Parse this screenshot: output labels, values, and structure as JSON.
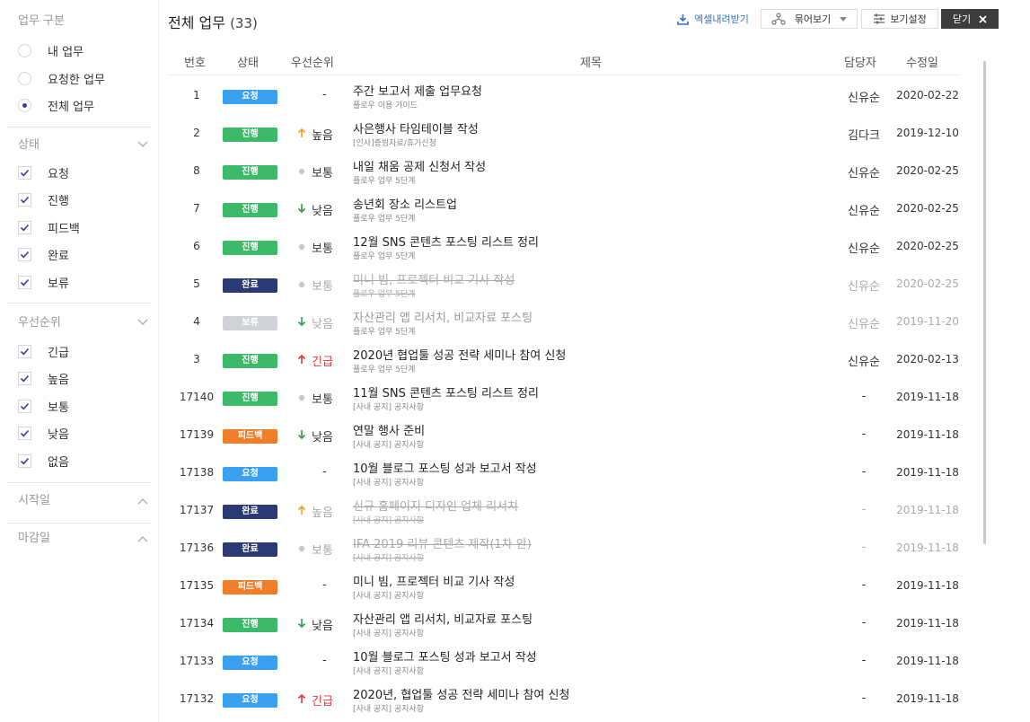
{
  "sidebar": {
    "work_type": {
      "title": "업무 구분",
      "options": [
        {
          "label": "내 업무",
          "selected": false
        },
        {
          "label": "요청한 업무",
          "selected": false
        },
        {
          "label": "전체 업무",
          "selected": true
        }
      ]
    },
    "status": {
      "title": "상태",
      "options": [
        {
          "label": "요청",
          "checked": true
        },
        {
          "label": "진행",
          "checked": true
        },
        {
          "label": "피드백",
          "checked": true
        },
        {
          "label": "완료",
          "checked": true
        },
        {
          "label": "보류",
          "checked": true
        }
      ]
    },
    "priority": {
      "title": "우선순위",
      "options": [
        {
          "label": "긴급",
          "checked": true
        },
        {
          "label": "높음",
          "checked": true
        },
        {
          "label": "보통",
          "checked": true
        },
        {
          "label": "낮음",
          "checked": true
        },
        {
          "label": "없음",
          "checked": true
        }
      ]
    },
    "start_date": {
      "title": "시작일"
    },
    "due_date": {
      "title": "마감일"
    }
  },
  "header": {
    "title": "전체 업무",
    "count": "(33)",
    "excel_label": "엑셀내려받기",
    "group_label": "묶어보기",
    "view_settings_label": "보기설정",
    "close_label": "닫기"
  },
  "columns": {
    "no": "번호",
    "status": "상태",
    "priority": "우선순위",
    "title": "제목",
    "assignee": "담당자",
    "modified": "수정일"
  },
  "colors": {
    "요청": "#3aa0f0",
    "진행": "#3cba6a",
    "완료": "#2c3a74",
    "보류": "#cfd2d6",
    "피드백": "#f07d28",
    "urgent": "#e03a3a",
    "high": "#f0a020",
    "low": "#2e9c4a",
    "normal": "#c6c6c6"
  },
  "rows": [
    {
      "no": "1",
      "status": "요청",
      "priority": "-",
      "title": "주간 보고서 제출 업무요청",
      "sub": "플로우 이용 가이드",
      "assignee": "신유순",
      "date": "2020-02-22"
    },
    {
      "no": "2",
      "status": "진행",
      "priority": "높음",
      "title": "사은행사 타임테이블 작성",
      "sub": "[인사]증빙자료/휴가신청",
      "assignee": "김다크",
      "date": "2019-12-10"
    },
    {
      "no": "8",
      "status": "진행",
      "priority": "보통",
      "title": "내일 채움 공제 신청서 작성",
      "sub": "플로우 업무 5단계",
      "assignee": "신유순",
      "date": "2020-02-25"
    },
    {
      "no": "7",
      "status": "진행",
      "priority": "낮음",
      "title": "송년회 장소 리스트업",
      "sub": "플로우 업무 5단계",
      "assignee": "신유순",
      "date": "2020-02-25"
    },
    {
      "no": "6",
      "status": "진행",
      "priority": "보통",
      "title": "12월 SNS 콘텐츠 포스팅 리스트 정리",
      "sub": "플로우 업무 5단계",
      "assignee": "신유순",
      "date": "2020-02-25"
    },
    {
      "no": "5",
      "status": "완료",
      "priority": "보통",
      "title": "미니 빔, 프로젝터 비교 기사 작성",
      "sub": "플로우 업무 5단계",
      "assignee": "신유순",
      "date": "2020-02-25"
    },
    {
      "no": "4",
      "status": "보류",
      "priority": "낮음",
      "title": "자산관리 앱 리서치, 비교자료 포스팅",
      "sub": "플로우 업무 5단계",
      "assignee": "신유순",
      "date": "2019-11-20"
    },
    {
      "no": "3",
      "status": "진행",
      "priority": "긴급",
      "title": "2020년 협업툴 성공 전략 세미나 참여 신청",
      "sub": "플로우 업무 5단계",
      "assignee": "신유순",
      "date": "2020-02-13"
    },
    {
      "no": "17140",
      "status": "진행",
      "priority": "보통",
      "title": "11월 SNS 콘텐츠 포스팅 리스트 정리",
      "sub": "[사내 공지] 공지사항",
      "assignee": "-",
      "date": "2019-11-18"
    },
    {
      "no": "17139",
      "status": "피드백",
      "priority": "낮음",
      "title": "연말 행사 준비",
      "sub": "[사내 공지] 공지사항",
      "assignee": "-",
      "date": "2019-11-18"
    },
    {
      "no": "17138",
      "status": "요청",
      "priority": "-",
      "title": "10월 블로그 포스팅 성과 보고서 작성",
      "sub": "[사내 공지] 공지사항",
      "assignee": "-",
      "date": "2019-11-18"
    },
    {
      "no": "17137",
      "status": "완료",
      "priority": "높음",
      "title": "신규 홈페이지 디자인 업체 리서치",
      "sub": "[사내 공지] 공지사항",
      "assignee": "-",
      "date": "2019-11-18"
    },
    {
      "no": "17136",
      "status": "완료",
      "priority": "보통",
      "title": "IFA 2019 리뷰 콘텐츠 제작(1차 안)",
      "sub": "[사내 공지] 공지사항",
      "assignee": "-",
      "date": "2019-11-18"
    },
    {
      "no": "17135",
      "status": "피드백",
      "priority": "-",
      "title": "미니 빔, 프로젝터 비교 기사 작성",
      "sub": "[사내 공지] 공지사항",
      "assignee": "-",
      "date": "2019-11-18"
    },
    {
      "no": "17134",
      "status": "진행",
      "priority": "낮음",
      "title": "자산관리 앱 리서치, 비교자료 포스팅",
      "sub": "[사내 공지] 공지사항",
      "assignee": "-",
      "date": "2019-11-18"
    },
    {
      "no": "17133",
      "status": "요청",
      "priority": "-",
      "title": "10월 블로그 포스팅 성과 보고서 작성",
      "sub": "[사내 공지] 공지사항",
      "assignee": "-",
      "date": "2019-11-18"
    },
    {
      "no": "17132",
      "status": "요청",
      "priority": "긴급",
      "title": "2020년, 협업툴 성공 전략 세미나 참여 신청",
      "sub": "[사내 공지] 공지사항",
      "assignee": "-",
      "date": "2019-11-18"
    }
  ]
}
